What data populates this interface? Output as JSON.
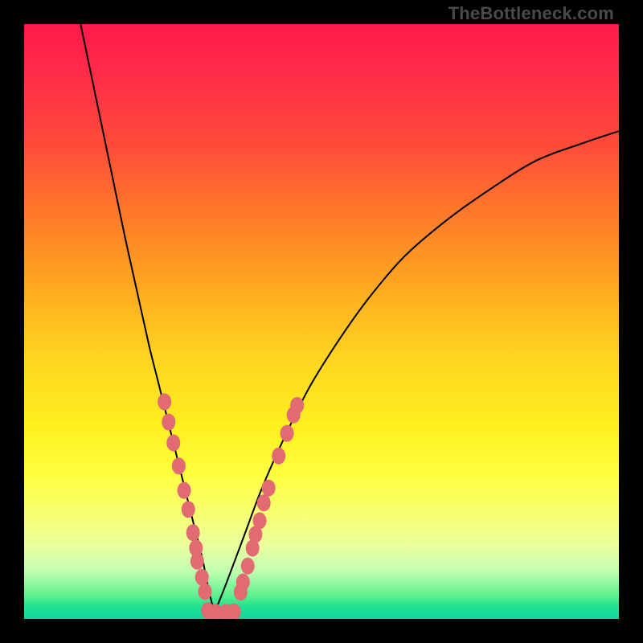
{
  "watermark": "TheBottleneck.com",
  "colors": {
    "frame": "#000000",
    "curve": "#000000",
    "dot": "#e16a73",
    "gradient_top": "#ff1a4a",
    "gradient_bottom": "#10d8a0"
  },
  "chart_data": {
    "type": "line",
    "title": "",
    "xlabel": "",
    "ylabel": "",
    "xlim": [
      0,
      100
    ],
    "ylim": [
      0,
      100
    ],
    "note": "No axes or tick labels rendered; values estimated from pixel positions on a 0–100 virtual grid. Higher y = lower bottleneck (V-shaped bottleneck curve).",
    "series": [
      {
        "name": "left-branch",
        "x": [
          9.5,
          12,
          14.5,
          17,
          19,
          21,
          22.5,
          24,
          25.5,
          27,
          28.5,
          30,
          31,
          32
        ],
        "y": [
          100,
          88,
          76,
          64,
          55,
          46,
          40,
          34,
          28,
          22,
          16,
          10,
          5,
          1
        ]
      },
      {
        "name": "right-branch",
        "x": [
          32,
          34,
          37,
          40,
          44,
          48,
          53,
          58,
          64,
          71,
          78,
          86,
          94,
          100
        ],
        "y": [
          1,
          6,
          14,
          22,
          31,
          39,
          47,
          54,
          61,
          67,
          72,
          77,
          80,
          82
        ]
      }
    ],
    "scatter": {
      "name": "highlight-dots",
      "points": [
        {
          "x": 23.6,
          "y": 36.5
        },
        {
          "x": 24.3,
          "y": 33.1
        },
        {
          "x": 25.1,
          "y": 29.6
        },
        {
          "x": 26.0,
          "y": 25.7
        },
        {
          "x": 26.9,
          "y": 21.6
        },
        {
          "x": 27.6,
          "y": 18.4
        },
        {
          "x": 28.4,
          "y": 14.5
        },
        {
          "x": 28.9,
          "y": 11.9
        },
        {
          "x": 29.1,
          "y": 9.7
        },
        {
          "x": 29.9,
          "y": 7.0
        },
        {
          "x": 30.4,
          "y": 4.6
        },
        {
          "x": 30.9,
          "y": 1.4
        },
        {
          "x": 32.2,
          "y": 1.1
        },
        {
          "x": 33.9,
          "y": 1.1
        },
        {
          "x": 35.3,
          "y": 1.2
        },
        {
          "x": 36.4,
          "y": 4.5
        },
        {
          "x": 36.8,
          "y": 6.2
        },
        {
          "x": 37.6,
          "y": 8.9
        },
        {
          "x": 38.4,
          "y": 11.9
        },
        {
          "x": 38.9,
          "y": 14.2
        },
        {
          "x": 39.6,
          "y": 16.5
        },
        {
          "x": 40.3,
          "y": 19.5
        },
        {
          "x": 41.1,
          "y": 22.0
        },
        {
          "x": 42.8,
          "y": 27.4
        },
        {
          "x": 44.2,
          "y": 31.2
        },
        {
          "x": 45.3,
          "y": 34.3
        },
        {
          "x": 45.9,
          "y": 35.9
        }
      ]
    }
  }
}
